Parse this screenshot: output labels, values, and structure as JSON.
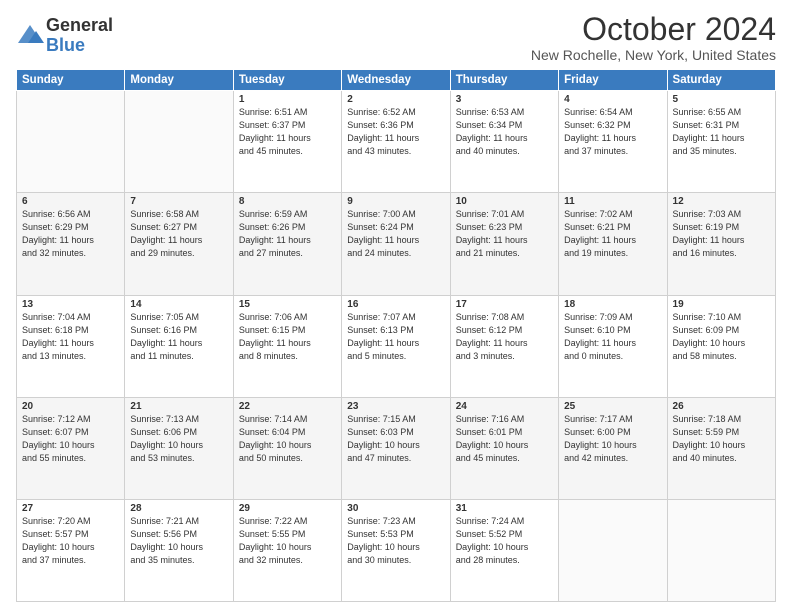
{
  "logo": {
    "general": "General",
    "blue": "Blue"
  },
  "title": "October 2024",
  "location": "New Rochelle, New York, United States",
  "days_of_week": [
    "Sunday",
    "Monday",
    "Tuesday",
    "Wednesday",
    "Thursday",
    "Friday",
    "Saturday"
  ],
  "weeks": [
    [
      {
        "day": "",
        "detail": ""
      },
      {
        "day": "",
        "detail": ""
      },
      {
        "day": "1",
        "detail": "Sunrise: 6:51 AM\nSunset: 6:37 PM\nDaylight: 11 hours\nand 45 minutes."
      },
      {
        "day": "2",
        "detail": "Sunrise: 6:52 AM\nSunset: 6:36 PM\nDaylight: 11 hours\nand 43 minutes."
      },
      {
        "day": "3",
        "detail": "Sunrise: 6:53 AM\nSunset: 6:34 PM\nDaylight: 11 hours\nand 40 minutes."
      },
      {
        "day": "4",
        "detail": "Sunrise: 6:54 AM\nSunset: 6:32 PM\nDaylight: 11 hours\nand 37 minutes."
      },
      {
        "day": "5",
        "detail": "Sunrise: 6:55 AM\nSunset: 6:31 PM\nDaylight: 11 hours\nand 35 minutes."
      }
    ],
    [
      {
        "day": "6",
        "detail": "Sunrise: 6:56 AM\nSunset: 6:29 PM\nDaylight: 11 hours\nand 32 minutes."
      },
      {
        "day": "7",
        "detail": "Sunrise: 6:58 AM\nSunset: 6:27 PM\nDaylight: 11 hours\nand 29 minutes."
      },
      {
        "day": "8",
        "detail": "Sunrise: 6:59 AM\nSunset: 6:26 PM\nDaylight: 11 hours\nand 27 minutes."
      },
      {
        "day": "9",
        "detail": "Sunrise: 7:00 AM\nSunset: 6:24 PM\nDaylight: 11 hours\nand 24 minutes."
      },
      {
        "day": "10",
        "detail": "Sunrise: 7:01 AM\nSunset: 6:23 PM\nDaylight: 11 hours\nand 21 minutes."
      },
      {
        "day": "11",
        "detail": "Sunrise: 7:02 AM\nSunset: 6:21 PM\nDaylight: 11 hours\nand 19 minutes."
      },
      {
        "day": "12",
        "detail": "Sunrise: 7:03 AM\nSunset: 6:19 PM\nDaylight: 11 hours\nand 16 minutes."
      }
    ],
    [
      {
        "day": "13",
        "detail": "Sunrise: 7:04 AM\nSunset: 6:18 PM\nDaylight: 11 hours\nand 13 minutes."
      },
      {
        "day": "14",
        "detail": "Sunrise: 7:05 AM\nSunset: 6:16 PM\nDaylight: 11 hours\nand 11 minutes."
      },
      {
        "day": "15",
        "detail": "Sunrise: 7:06 AM\nSunset: 6:15 PM\nDaylight: 11 hours\nand 8 minutes."
      },
      {
        "day": "16",
        "detail": "Sunrise: 7:07 AM\nSunset: 6:13 PM\nDaylight: 11 hours\nand 5 minutes."
      },
      {
        "day": "17",
        "detail": "Sunrise: 7:08 AM\nSunset: 6:12 PM\nDaylight: 11 hours\nand 3 minutes."
      },
      {
        "day": "18",
        "detail": "Sunrise: 7:09 AM\nSunset: 6:10 PM\nDaylight: 11 hours\nand 0 minutes."
      },
      {
        "day": "19",
        "detail": "Sunrise: 7:10 AM\nSunset: 6:09 PM\nDaylight: 10 hours\nand 58 minutes."
      }
    ],
    [
      {
        "day": "20",
        "detail": "Sunrise: 7:12 AM\nSunset: 6:07 PM\nDaylight: 10 hours\nand 55 minutes."
      },
      {
        "day": "21",
        "detail": "Sunrise: 7:13 AM\nSunset: 6:06 PM\nDaylight: 10 hours\nand 53 minutes."
      },
      {
        "day": "22",
        "detail": "Sunrise: 7:14 AM\nSunset: 6:04 PM\nDaylight: 10 hours\nand 50 minutes."
      },
      {
        "day": "23",
        "detail": "Sunrise: 7:15 AM\nSunset: 6:03 PM\nDaylight: 10 hours\nand 47 minutes."
      },
      {
        "day": "24",
        "detail": "Sunrise: 7:16 AM\nSunset: 6:01 PM\nDaylight: 10 hours\nand 45 minutes."
      },
      {
        "day": "25",
        "detail": "Sunrise: 7:17 AM\nSunset: 6:00 PM\nDaylight: 10 hours\nand 42 minutes."
      },
      {
        "day": "26",
        "detail": "Sunrise: 7:18 AM\nSunset: 5:59 PM\nDaylight: 10 hours\nand 40 minutes."
      }
    ],
    [
      {
        "day": "27",
        "detail": "Sunrise: 7:20 AM\nSunset: 5:57 PM\nDaylight: 10 hours\nand 37 minutes."
      },
      {
        "day": "28",
        "detail": "Sunrise: 7:21 AM\nSunset: 5:56 PM\nDaylight: 10 hours\nand 35 minutes."
      },
      {
        "day": "29",
        "detail": "Sunrise: 7:22 AM\nSunset: 5:55 PM\nDaylight: 10 hours\nand 32 minutes."
      },
      {
        "day": "30",
        "detail": "Sunrise: 7:23 AM\nSunset: 5:53 PM\nDaylight: 10 hours\nand 30 minutes."
      },
      {
        "day": "31",
        "detail": "Sunrise: 7:24 AM\nSunset: 5:52 PM\nDaylight: 10 hours\nand 28 minutes."
      },
      {
        "day": "",
        "detail": ""
      },
      {
        "day": "",
        "detail": ""
      }
    ]
  ]
}
